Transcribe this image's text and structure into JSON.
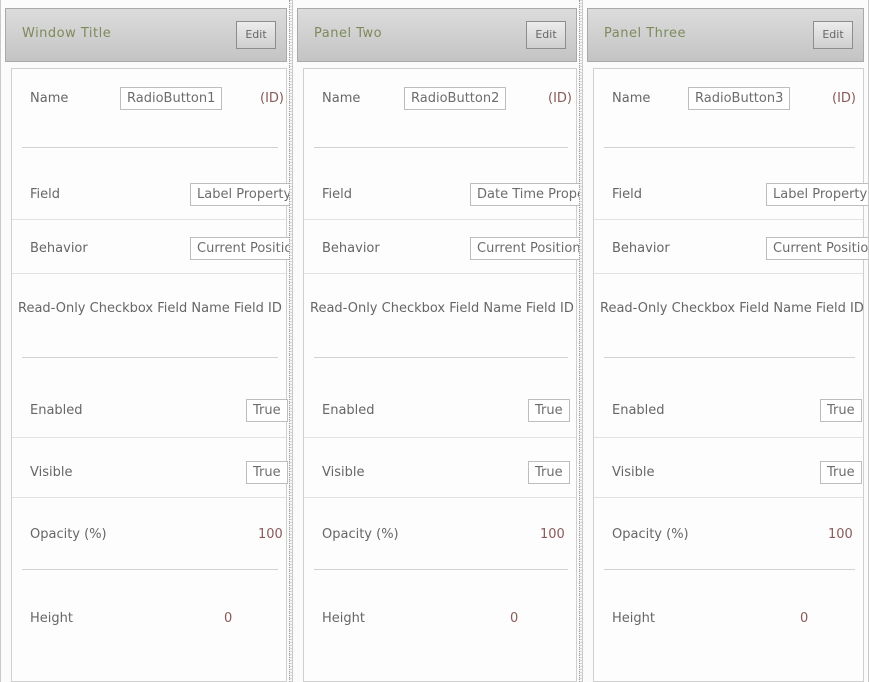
{
  "panels": [
    {
      "header_title": "Window Title",
      "header_button": "Edit",
      "name_label": "Name",
      "name_value": "RadioButton1",
      "name_extra": "(ID)",
      "field1_label": "Field",
      "field1_value": "Label Property",
      "field2_label": "Behavior",
      "field2_value": "Current Position",
      "long_row": "Read-Only Checkbox Field Name Field ID",
      "toggle1_label": "Enabled",
      "toggle1_value": "True",
      "toggle2_label": "Visible",
      "toggle2_value": "True",
      "opacity_label": "Opacity (%)",
      "opacity_value": "100",
      "height_label": "Height",
      "height_value": "0"
    },
    {
      "header_title": "Panel Two",
      "header_button": "Edit",
      "name_label": "Name",
      "name_value": "RadioButton2",
      "name_extra": "(ID)",
      "field1_label": "Field",
      "field1_value": "Date Time Property",
      "field2_label": "Behavior",
      "field2_value": "Current Position",
      "long_row": "Read-Only Checkbox Field Name Field ID",
      "toggle1_label": "Enabled",
      "toggle1_value": "True",
      "toggle2_label": "Visible",
      "toggle2_value": "True",
      "opacity_label": "Opacity (%)",
      "opacity_value": "100",
      "height_label": "Height",
      "height_value": "0"
    },
    {
      "header_title": "Panel Three",
      "header_button": "Edit",
      "name_label": "Name",
      "name_value": "RadioButton3",
      "name_extra": "(ID)",
      "field1_label": "Field",
      "field1_value": "Label Property",
      "field2_label": "Behavior",
      "field2_value": "Current Position",
      "long_row": "Read-Only Checkbox Field Name Field ID",
      "toggle1_label": "Enabled",
      "toggle1_value": "True",
      "toggle2_label": "Visible",
      "toggle2_value": "True",
      "opacity_label": "Opacity (%)",
      "opacity_value": "100",
      "height_label": "Height",
      "height_value": "0"
    }
  ]
}
